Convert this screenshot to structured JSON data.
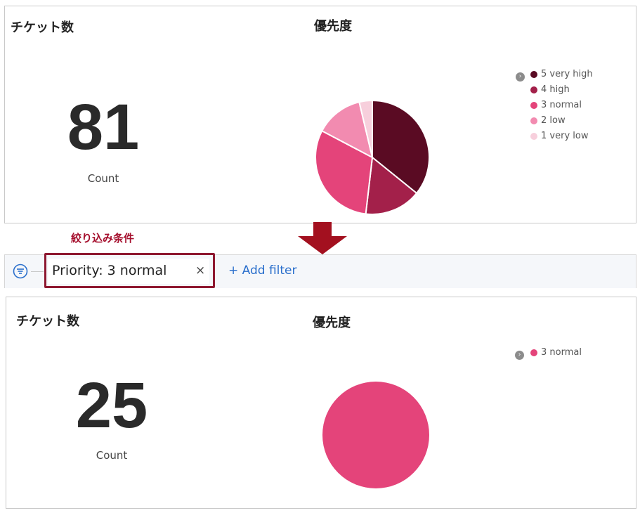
{
  "top_panel": {
    "count_title": "チケット数",
    "count_value": "81",
    "count_label": "Count",
    "priority_title": "優先度",
    "legend_toggle": "›",
    "legend": [
      {
        "label": "5 very high",
        "color": "#5a0b23"
      },
      {
        "label": "4 high",
        "color": "#a3204a"
      },
      {
        "label": "3 normal",
        "color": "#e4447a"
      },
      {
        "label": "2 low",
        "color": "#f28bb0"
      },
      {
        "label": "1 very low",
        "color": "#f7cfdc"
      }
    ]
  },
  "annotation": {
    "text": "絞り込み条件",
    "color": "#a50f2d"
  },
  "filter_bar": {
    "pill_label": "Priority: 3 normal",
    "pill_close": "×",
    "add_filter": "+ Add filter"
  },
  "bottom_panel": {
    "count_title": "チケット数",
    "count_value": "25",
    "count_label": "Count",
    "priority_title": "優先度",
    "legend_toggle": "›",
    "legend": [
      {
        "label": "3 normal",
        "color": "#e4447a"
      }
    ]
  },
  "chart_data": [
    {
      "type": "pie",
      "categories": [
        "5 very high",
        "4 high",
        "3 normal",
        "2 low",
        "1 very low"
      ],
      "values": [
        29,
        13,
        25,
        11,
        3
      ],
      "colors": [
        "#5a0b23",
        "#a3204a",
        "#e4447a",
        "#f28bb0",
        "#f7cfdc"
      ],
      "title": "優先度",
      "legend_position": "right"
    },
    {
      "type": "pie",
      "categories": [
        "3 normal"
      ],
      "values": [
        25
      ],
      "colors": [
        "#e4447a"
      ],
      "title": "優先度",
      "legend_position": "right"
    }
  ]
}
